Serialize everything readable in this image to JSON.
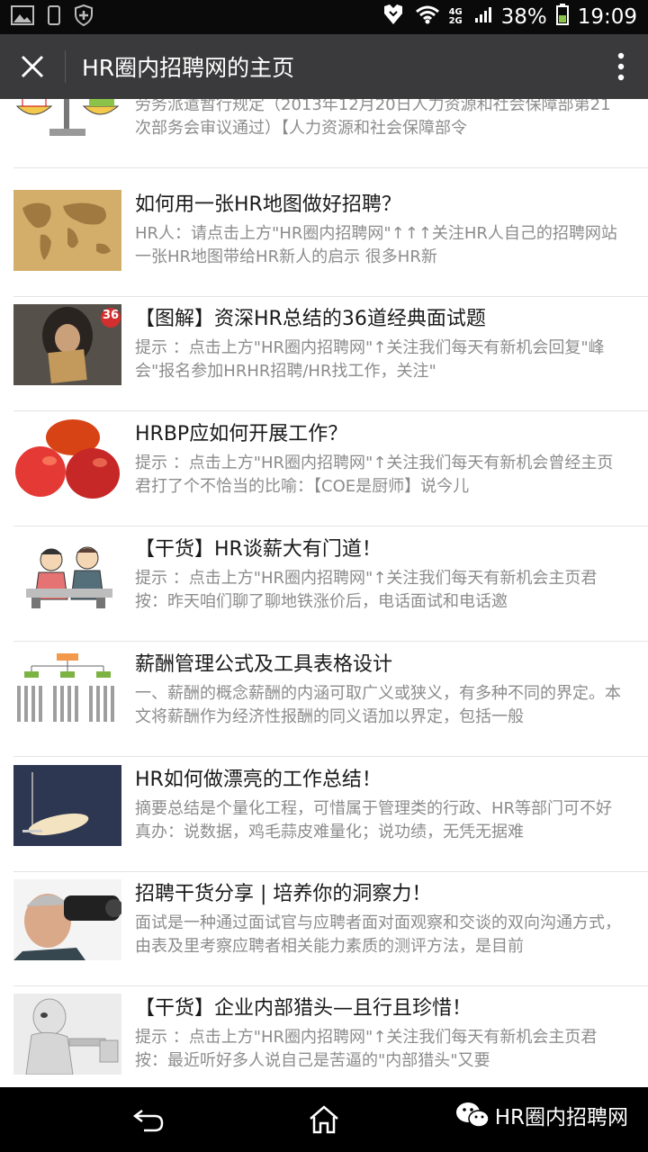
{
  "status_bar": {
    "network": "4G 2G",
    "battery_percent": "38%",
    "time": "19:09"
  },
  "app_bar": {
    "title": "HR圈内招聘网的主页"
  },
  "articles": [
    {
      "title": "",
      "desc": "劳务派遣暂行规定（2013年12月20日人力资源和社会保障部第21次部务会审议通过）【人力资源和社会保障部令",
      "thumb_icon": "scale-cartoon-icon"
    },
    {
      "title": "如何用一张HR地图做好招聘？",
      "desc": "HR人：请点击上方\"HR圈内招聘网\"↑↑↑关注HR人自己的招聘网站一张HR地图带给HR新人的启示 很多HR新",
      "thumb_icon": "world-map-icon"
    },
    {
      "title": "【图解】资深HR总结的36道经典面试题",
      "desc": "提示 ：点击上方\"HR圈内招聘网\"↑关注我们每天有新机会回复\"峰会\"报名参加HRHR招聘/HR找工作，关注\"",
      "thumb_icon": "sign-holder-icon",
      "thumb_badge": "36"
    },
    {
      "title": "HRBP应如何开展工作？",
      "desc": "提示 ：点击上方\"HR圈内招聘网\"↑关注我们每天有新机会曾经主页君打了个不恰当的比喻：【COE是厨师】说今儿",
      "thumb_icon": "mango-icon"
    },
    {
      "title": "【干货】HR谈薪大有门道！",
      "desc": "提示 ：点击上方\"HR圈内招聘网\"↑关注我们每天有新机会主页君按：昨天咱们聊了聊地铁涨价后，电话面试和电话邀",
      "thumb_icon": "negotiation-cartoon-icon"
    },
    {
      "title": "薪酬管理公式及工具表格设计",
      "desc": "一、薪酬的概念薪酬的内涵可取广义或狭义，有多种不同的界定。本文将薪酬作为经济性报酬的同义语加以界定，包括一般",
      "thumb_icon": "org-chart-icon"
    },
    {
      "title": "HR如何做漂亮的工作总结！",
      "desc": "摘要总结是个量化工程，可惜属于管理类的行政、HR等部门可不好真办：说数据，鸡毛蒜皮难量化；说功绩，无凭无据难",
      "thumb_icon": "spotlight-slide-icon"
    },
    {
      "title": "招聘干货分享 | 培养你的洞察力！",
      "desc": "面试是一种通过面试官与应聘者面对面观察和交谈的双向沟通方式，由表及里考察应聘者相关能力素质的测评方法，是目前",
      "thumb_icon": "binoculars-icon"
    },
    {
      "title": "【干货】企业内部猎头—且行且珍惜！",
      "desc": "提示 ：点击上方\"HR圈内招聘网\"↑关注我们每天有新机会主页君按：最近听好多人说自己是苦逼的\"内部猎头\"又要",
      "thumb_icon": "robot-icon"
    }
  ],
  "nav_bar": {
    "watermark": "HR圈内招聘网"
  },
  "colors": {
    "app_bar": "#3a3a3c",
    "status_bar": "#0a0a0a",
    "title_text": "#1a1a1a",
    "desc_text": "#8c8c8c",
    "battery": "#8bc34a"
  }
}
